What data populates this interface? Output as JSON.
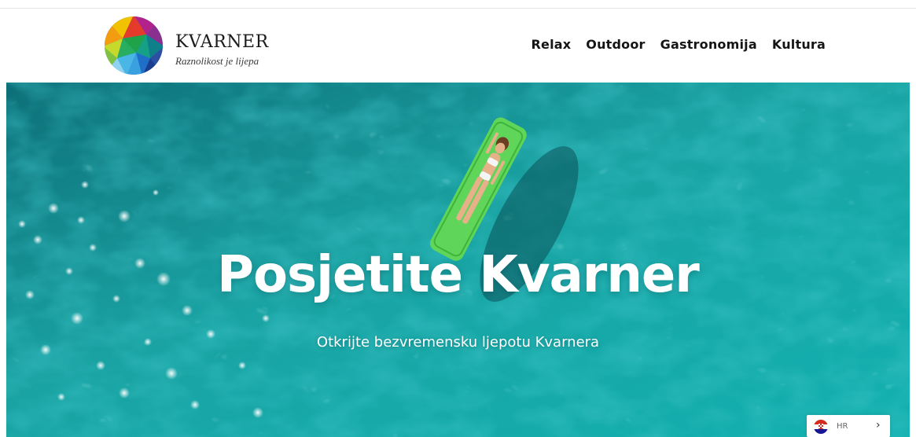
{
  "header": {
    "logo": {
      "name": "KVARNER",
      "tagline": "Raznolikost je lijepa"
    },
    "nav": [
      {
        "label": "Relax"
      },
      {
        "label": "Outdoor"
      },
      {
        "label": "Gastronomija"
      },
      {
        "label": "Kultura"
      }
    ]
  },
  "hero": {
    "title": "Posjetite Kvarner",
    "subtitle": "Otkrijte bezvremensku ljepotu Kvarnera",
    "image": "aerial sea water with woman on green float",
    "colors": {
      "water": "#1aa3a3",
      "float": "#5fd65a"
    }
  },
  "language_switcher": {
    "code": "HR",
    "flag_icon": "croatia-flag-icon",
    "chevron_icon": "chevron-right-icon"
  },
  "colors": {
    "nav_text": "#151515",
    "hero_text": "#ffffff"
  }
}
